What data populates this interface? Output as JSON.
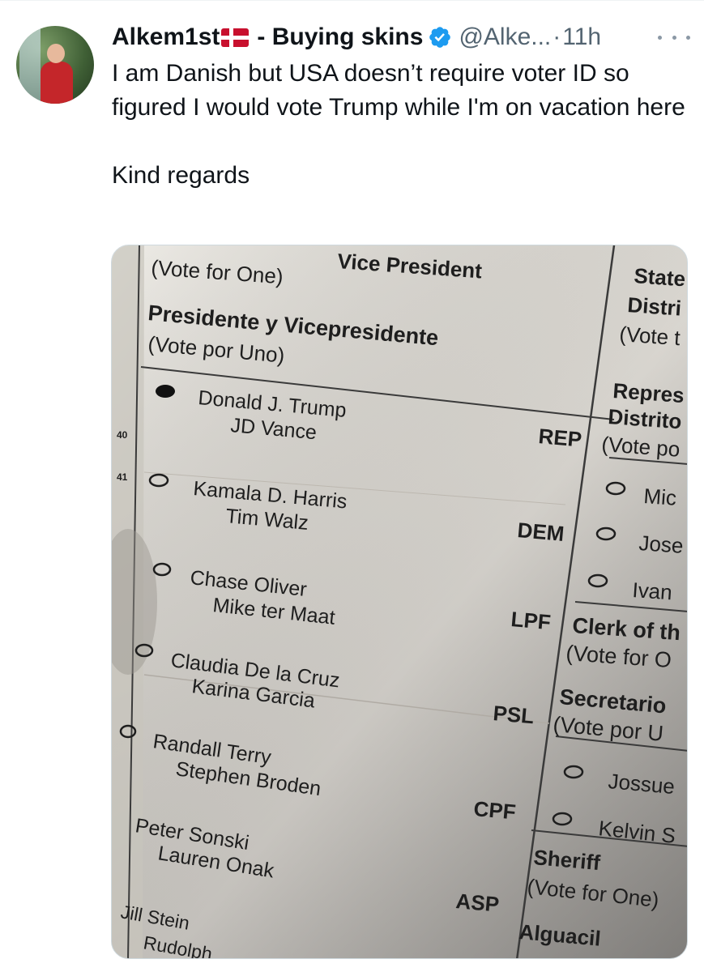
{
  "author": {
    "display_name": "Alkem1st",
    "flag_icon": "denmark-flag-icon",
    "name_suffix": "- Buying skins",
    "verified_icon": "verified-badge-icon",
    "handle": "@Alke...",
    "separator": "·",
    "time": "11h"
  },
  "tweet": {
    "text": "I am Danish but USA doesn’t require voter ID so figured I would vote Trump while I'm on vacation here\n\nKind regards"
  },
  "colors": {
    "verified": "#1d9bf0",
    "secondary_text": "#536471"
  },
  "ballot": {
    "heading_top": "Vice President",
    "vote_for_one": "(Vote for One)",
    "heading_es": "Presidente y Vicepresidente",
    "vote_por_uno": "(Vote por Uno)",
    "row_num_40": "40",
    "row_num_41": "41",
    "candidates": [
      {
        "line1": "Donald J. Trump",
        "line2": "JD Vance",
        "party": "REP"
      },
      {
        "line1": "Kamala D. Harris",
        "line2": "Tim Walz",
        "party": "DEM"
      },
      {
        "line1": "Chase Oliver",
        "line2": "Mike ter Maat",
        "party": "LPF"
      },
      {
        "line1": "Claudia De la Cruz",
        "line2": "Karina Garcia",
        "party": "PSL"
      },
      {
        "line1": "Randall Terry",
        "line2": "Stephen Broden",
        "party": "CPF"
      },
      {
        "line1": "Peter Sonski",
        "line2": "Lauren Onak",
        "party": "ASP"
      },
      {
        "line1": "Jill Stein",
        "line2": "Rudolph",
        "party": ""
      }
    ],
    "right": {
      "state": "State",
      "distri": "Distri",
      "vote_t": "(Vote t",
      "repres": "Repres",
      "distrito": "Distrito",
      "vote_po": "(Vote po",
      "names": [
        "Mic",
        "Jose",
        "Ivan"
      ],
      "clerk": "Clerk of th",
      "vote_for_o": "(Vote for O",
      "secretario": "Secretario",
      "vote_por_u": "(Vote por U",
      "names2": [
        "Jossue",
        "Kelvin S"
      ],
      "sheriff": "Sheriff",
      "sheriff_vote": "(Vote for One)",
      "alguacil": "Alguacil"
    }
  }
}
